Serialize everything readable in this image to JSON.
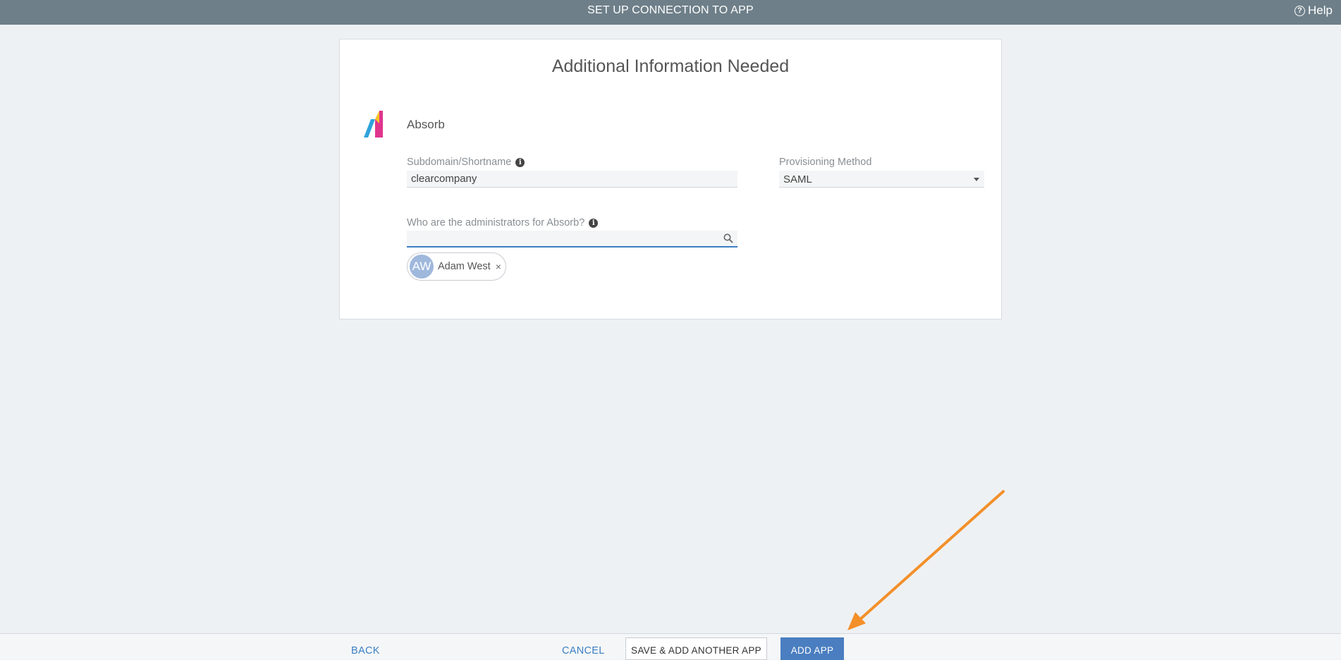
{
  "header": {
    "title": "SET UP CONNECTION TO APP",
    "help_label": "Help",
    "help_icon": "question-circle-icon"
  },
  "card": {
    "heading": "Additional Information Needed",
    "app": {
      "name": "Absorb",
      "logo_icon": "absorb-logo",
      "logo_colors": [
        "#f5c423",
        "#e0358d",
        "#2ea3dc"
      ]
    },
    "subdomain": {
      "label": "Subdomain/Shortname",
      "value": "clearcompany"
    },
    "provisioning": {
      "label": "Provisioning Method",
      "value": "SAML"
    },
    "administrators": {
      "label": "Who are the administrators for Absorb?",
      "search_value": "",
      "selected": [
        {
          "initials": "AW",
          "name": "Adam West",
          "remove_label": "×"
        }
      ]
    }
  },
  "footer": {
    "back_label": "BACK",
    "cancel_label": "CANCEL",
    "save_add_label": "SAVE & ADD ANOTHER APP",
    "add_app_label": "ADD APP"
  },
  "colors": {
    "header_bg": "#6e7f89",
    "primary": "#4a7ec0",
    "link": "#3a7fc4",
    "annotation_arrow": "#f3902a"
  }
}
